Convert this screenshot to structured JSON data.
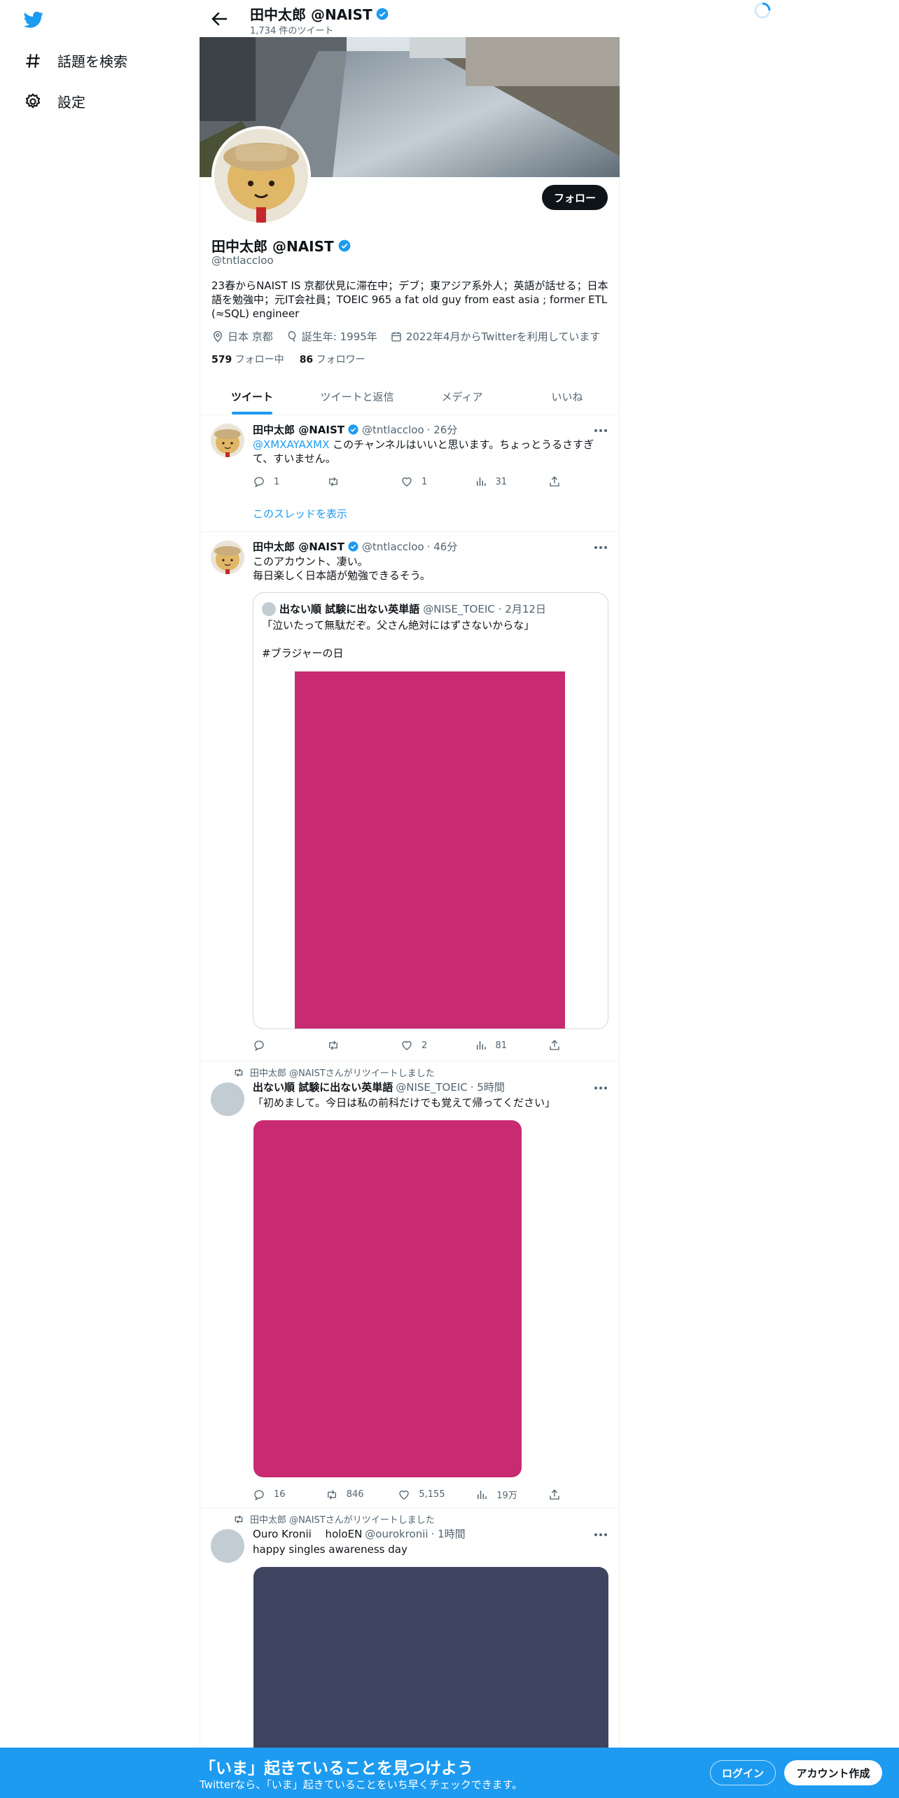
{
  "nav": {
    "explore_label": "話題を検索",
    "settings_label": "設定"
  },
  "header": {
    "name": "田中太郎 @NAIST",
    "tweet_count": "1,734 件のツイート"
  },
  "profile": {
    "name": "田中太郎 @NAIST",
    "handle": "@tntlaccloo",
    "follow_label": "フォロー",
    "bio": "23春からNAIST IS 京都伏見に滞在中；デブ；東アジア系外人；英語が話せる；日本語を勉強中；元IT会社員；TOEIC 965 a fat old guy from east asia ; former ETL (≈SQL) engineer",
    "location": "日本 京都",
    "birthday": "誕生年: 1995年",
    "joined": "2022年4月からTwitterを利用しています",
    "following_count": "579",
    "following_label": "フォロー中",
    "followers_count": "86",
    "followers_label": "フォロワー"
  },
  "tabs": [
    "ツイート",
    "ツイートと返信",
    "メディア",
    "いいね"
  ],
  "tweets": [
    {
      "name": "田中太郎 @NAIST",
      "handle": "@tntlaccloo",
      "time": "· 26分",
      "mention": "@XMXAYAXMX",
      "text": " このチャンネルはいいと思います。ちょっとうるさすぎて、すいません。",
      "replies": "1",
      "retweets": "",
      "likes": "1",
      "views": "31",
      "thread_link": "このスレッドを表示"
    },
    {
      "name": "田中太郎 @NAIST",
      "handle": "@tntlaccloo",
      "time": "· 46分",
      "text": "このアカウント、凄い。\n毎日楽しく日本語が勉強できるそう。",
      "quote": {
        "name": "出ない順 試験に出ない英単語",
        "handle": "@NISE_TOEIC",
        "time": "· 2月12日",
        "text": "「泣いたって無駄だぞ。父さん絶対にはずさないからな」\n\n#ブラジャーの日"
      },
      "replies": "",
      "retweets": "",
      "likes": "2",
      "views": "81"
    },
    {
      "retweeted_by": "田中太郎 @NAISTさんがリツイートしました",
      "name": "出ない順 試験に出ない英単語",
      "handle": "@NISE_TOEIC",
      "time": "· 5時間",
      "text": "「初めまして。今日は私の前科だけでも覚えて帰ってください」",
      "replies": "16",
      "retweets": "846",
      "likes": "5,155",
      "views": "19万"
    },
    {
      "retweeted_by": "田中太郎 @NAISTさんがリツイートしました",
      "name": "Ouro Kronii　 holoEN",
      "handle": "@ourokronii",
      "time": "· 1時間",
      "text": "happy singles awareness day"
    }
  ],
  "bottom_bar": {
    "title": "「いま」起きていることを見つけよう",
    "subtitle": "Twitterなら、「いま」起きていることをいち早くチェックできます。",
    "login_label": "ログイン",
    "signup_label": "アカウント作成"
  },
  "colors": {
    "accent": "#1d9bf0",
    "media_pink": "#c82b72",
    "media_navy": "#3e4460"
  }
}
